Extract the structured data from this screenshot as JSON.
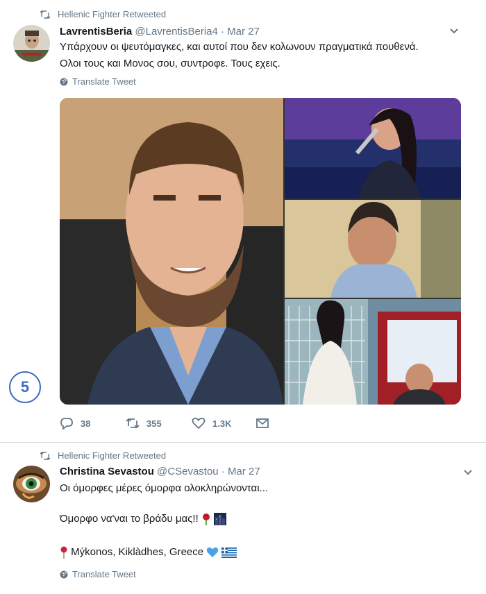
{
  "tweet1": {
    "retweeted_by": "Hellenic Fighter Retweeted",
    "author_name": "LavrentisBeria",
    "author_handle": "@LavrentisBeria4",
    "separator": "·",
    "date": "Mar 27",
    "text_line1": "Υπάρχουν οι ψευτόμαγκες, και αυτοί που δεν κολωνουν πραγματικά πουθενά.",
    "text_line2": "Ολοι τους και Μονος σου, συντροφε. Τους εχεις.",
    "translate_label": "Translate Tweet",
    "badge_number": "5",
    "replies": "38",
    "retweets": "355",
    "likes": "1.3K"
  },
  "tweet2": {
    "retweeted_by": "Hellenic Fighter Retweeted",
    "author_name": "Christina Sevastou",
    "author_handle": "@CSevastou",
    "separator": "·",
    "date": "Mar 27",
    "text_line1": "Οι όμορφες μέρες όμορφα ολοκληρώνονται...",
    "text_line2": "Όμορφο να'ναι το βράδυ μας!!",
    "text_line3": "Mýkonos, Kiklàdhes, Greece",
    "translate_label": "Translate Tweet"
  },
  "colors": {
    "secondary_text": "#657786",
    "badge_blue": "#3d6cc5",
    "primary_text": "#14171a"
  },
  "icons": [
    "retweet-icon",
    "chevron-down-icon",
    "globe-icon",
    "reply-icon",
    "heart-icon",
    "message-icon",
    "rose-emoji",
    "cityscape-emoji",
    "pin-emoji",
    "blue-heart-emoji",
    "greece-flag-emoji"
  ]
}
